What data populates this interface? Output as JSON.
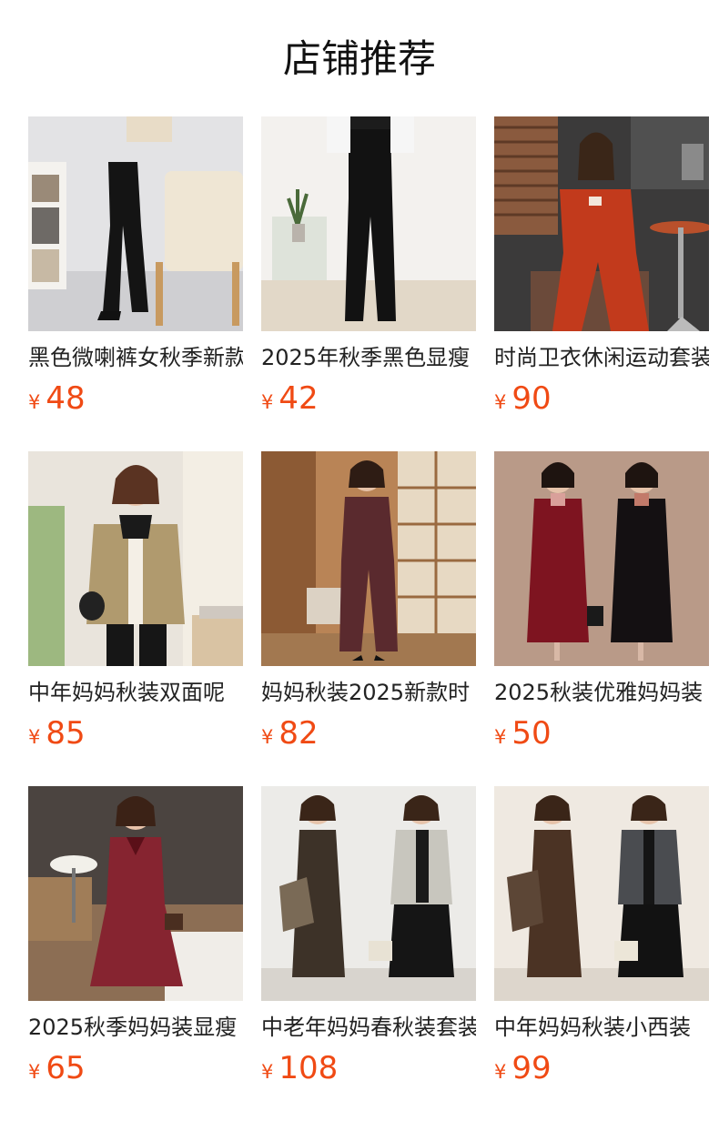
{
  "header": {
    "title": "店铺推荐"
  },
  "currency_symbol": "¥",
  "products": [
    {
      "name": "黑色微喇裤女秋季新款",
      "price": "48"
    },
    {
      "name": "2025年秋季黑色显瘦",
      "price": "42"
    },
    {
      "name": "时尚卫衣休闲运动套装",
      "price": "90"
    },
    {
      "name": "中年妈妈秋装双面呢",
      "price": "85"
    },
    {
      "name": "妈妈秋装2025新款时",
      "price": "82"
    },
    {
      "name": "2025秋装优雅妈妈装",
      "price": "50"
    },
    {
      "name": "2025秋季妈妈装显瘦",
      "price": "65"
    },
    {
      "name": "中老年妈妈春秋装套装",
      "price": "108"
    },
    {
      "name": "中年妈妈秋装小西装",
      "price": "99"
    }
  ]
}
